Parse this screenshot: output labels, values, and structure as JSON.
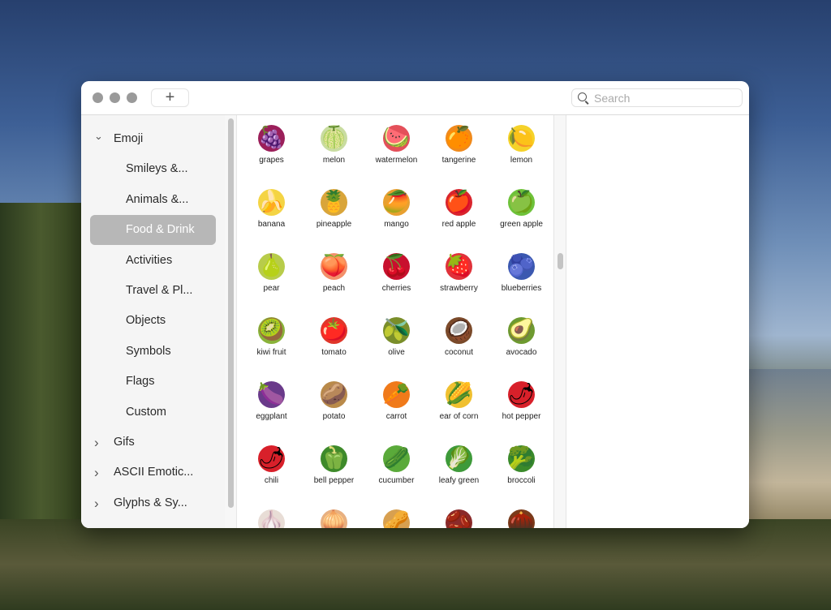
{
  "toolbar": {
    "add_label": "+",
    "search_placeholder": "Search"
  },
  "sidebar": {
    "items": [
      {
        "label": "Emoji",
        "level": 0,
        "expanded": true
      },
      {
        "label": "Smileys &...",
        "level": 1
      },
      {
        "label": "Animals &...",
        "level": 1
      },
      {
        "label": "Food & Drink",
        "level": 1,
        "selected": true
      },
      {
        "label": "Activities",
        "level": 1
      },
      {
        "label": "Travel & Pl...",
        "level": 1
      },
      {
        "label": "Objects",
        "level": 1
      },
      {
        "label": "Symbols",
        "level": 1
      },
      {
        "label": "Flags",
        "level": 1
      },
      {
        "label": "Custom",
        "level": 1
      },
      {
        "label": "Gifs",
        "level": 0,
        "expanded": false
      },
      {
        "label": "ASCII Emotic...",
        "level": 0,
        "expanded": false
      },
      {
        "label": "Glyphs & Sy...",
        "level": 0,
        "expanded": false
      }
    ]
  },
  "emoji": [
    {
      "c": "🍇",
      "n": "grapes",
      "col": "#9b1f5a"
    },
    {
      "c": "🍈",
      "n": "melon",
      "col": "#c9dca0"
    },
    {
      "c": "🍉",
      "n": "watermelon",
      "col": "#e4505a"
    },
    {
      "c": "🍊",
      "n": "tangerine",
      "col": "#f08a1c"
    },
    {
      "c": "🍋",
      "n": "lemon",
      "col": "#f5d22a"
    },
    {
      "c": "🍌",
      "n": "banana",
      "col": "#f4d444"
    },
    {
      "c": "🍍",
      "n": "pineapple",
      "col": "#d9a53a"
    },
    {
      "c": "🥭",
      "n": "mango",
      "col": "#e8a030"
    },
    {
      "c": "🍎",
      "n": "red apple",
      "col": "#d9252d"
    },
    {
      "c": "🍏",
      "n": "green apple",
      "col": "#6ec23a"
    },
    {
      "c": "🍐",
      "n": "pear",
      "col": "#b8cc4a"
    },
    {
      "c": "🍑",
      "n": "peach",
      "col": "#f3906a"
    },
    {
      "c": "🍒",
      "n": "cherries",
      "col": "#c8102e"
    },
    {
      "c": "🍓",
      "n": "strawberry",
      "col": "#e0323a"
    },
    {
      "c": "🫐",
      "n": "blueberries",
      "col": "#3b58b0"
    },
    {
      "c": "🥝",
      "n": "kiwi fruit",
      "col": "#8ab33a"
    },
    {
      "c": "🍅",
      "n": "tomato",
      "col": "#e0362a"
    },
    {
      "c": "🫒",
      "n": "olive",
      "col": "#7a8e2a"
    },
    {
      "c": "🥥",
      "n": "coconut",
      "col": "#7a4a2a"
    },
    {
      "c": "🥑",
      "n": "avocado",
      "col": "#6e9a30"
    },
    {
      "c": "🍆",
      "n": "eggplant",
      "col": "#6a3a8a"
    },
    {
      "c": "🥔",
      "n": "potato",
      "col": "#b98a4a"
    },
    {
      "c": "🥕",
      "n": "carrot",
      "col": "#f07a1a"
    },
    {
      "c": "🌽",
      "n": "ear of corn",
      "col": "#f0c030"
    },
    {
      "c": "🌶",
      "n": "hot pepper",
      "col": "#d8202a"
    },
    {
      "c": "🌶",
      "n": "chili",
      "col": "#d8202a"
    },
    {
      "c": "🫑",
      "n": "bell pepper",
      "col": "#3e8a2a"
    },
    {
      "c": "🥒",
      "n": "cucumber",
      "col": "#5aaa3a"
    },
    {
      "c": "🥬",
      "n": "leafy green",
      "col": "#3e9a3a"
    },
    {
      "c": "🥦",
      "n": "broccoli",
      "col": "#3a8a2a"
    },
    {
      "c": "🧄",
      "n": "",
      "col": "#e8ddd6"
    },
    {
      "c": "🧅",
      "n": "",
      "col": "#e8b080"
    },
    {
      "c": "🥜",
      "n": "",
      "col": "#d8a050"
    },
    {
      "c": "🫘",
      "n": "",
      "col": "#8a2a2a"
    },
    {
      "c": "🌰",
      "n": "",
      "col": "#7a3a1a"
    }
  ]
}
